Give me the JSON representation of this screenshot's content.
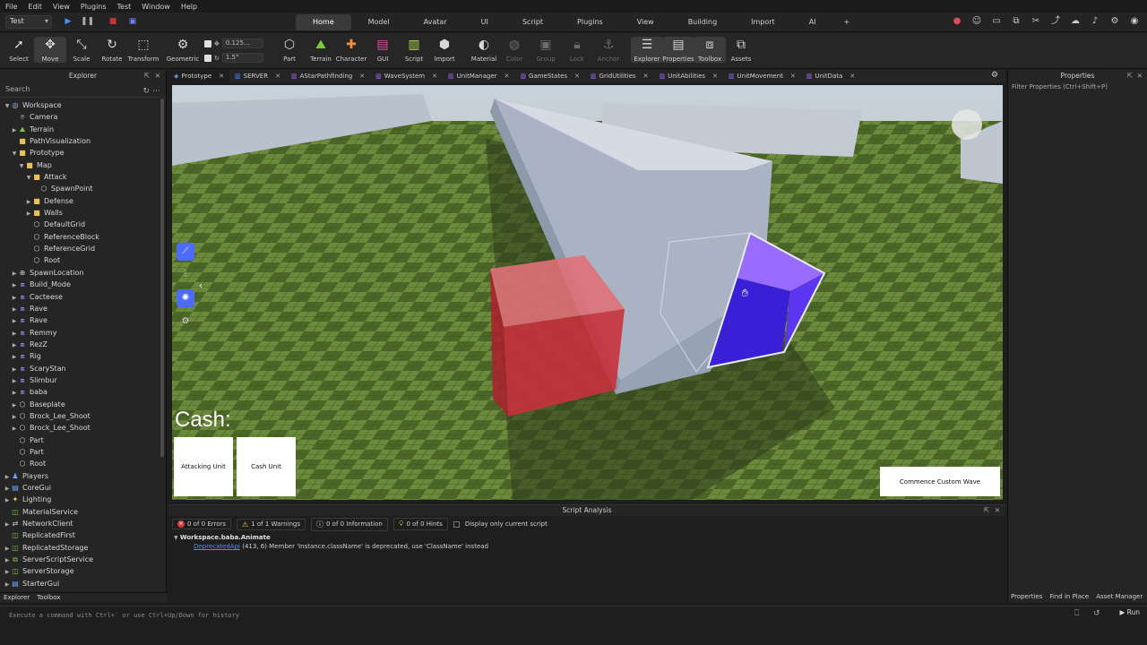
{
  "menu": [
    "File",
    "Edit",
    "View",
    "Plugins",
    "Test",
    "Window",
    "Help"
  ],
  "test_mode": "Test",
  "ribbon_tabs": [
    "Home",
    "Model",
    "Avatar",
    "UI",
    "Script",
    "Plugins",
    "View",
    "Building",
    "Import",
    "AI"
  ],
  "active_ribbon_tab": "Home",
  "toolbar": {
    "tools": [
      {
        "label": "Select",
        "icon": "cursor-icon"
      },
      {
        "label": "Move",
        "icon": "move-icon"
      },
      {
        "label": "Scale",
        "icon": "scale-icon"
      },
      {
        "label": "Rotate",
        "icon": "rotate-icon"
      },
      {
        "label": "Transform",
        "icon": "transform-icon"
      }
    ],
    "geometric_label": "Geometric",
    "snap_move": "0.125...",
    "snap_rotate": "1.5°",
    "insert_tools": [
      "Part",
      "Terrain",
      "Character",
      "GUI",
      "Script",
      "Import"
    ],
    "material_tools": [
      "Material",
      "Color",
      "Group",
      "Lock",
      "Anchor"
    ],
    "panel_tools": [
      "Explorer",
      "Properties",
      "Toolbox",
      "Assets"
    ]
  },
  "explorer": {
    "title": "Explorer",
    "search_placeholder": "Search",
    "items": [
      {
        "name": "Workspace",
        "depth": 0,
        "expand": "open",
        "icon": "workspace"
      },
      {
        "name": "Camera",
        "depth": 1,
        "expand": "",
        "icon": "camera"
      },
      {
        "name": "Terrain",
        "depth": 1,
        "expand": "closed",
        "icon": "terrain"
      },
      {
        "name": "PathVisualization",
        "depth": 1,
        "expand": "",
        "icon": "folder"
      },
      {
        "name": "Prototype",
        "depth": 1,
        "expand": "open",
        "icon": "folder"
      },
      {
        "name": "Map",
        "depth": 2,
        "expand": "open",
        "icon": "folder"
      },
      {
        "name": "Attack",
        "depth": 3,
        "expand": "open",
        "icon": "folder"
      },
      {
        "name": "SpawnPoint",
        "depth": 4,
        "expand": "",
        "icon": "part"
      },
      {
        "name": "Defense",
        "depth": 3,
        "expand": "closed",
        "icon": "folder"
      },
      {
        "name": "Walls",
        "depth": 3,
        "expand": "closed",
        "icon": "folder"
      },
      {
        "name": "DefaultGrid",
        "depth": 3,
        "expand": "",
        "icon": "part"
      },
      {
        "name": "ReferenceBlock",
        "depth": 3,
        "expand": "",
        "icon": "part"
      },
      {
        "name": "ReferenceGrid",
        "depth": 3,
        "expand": "",
        "icon": "part"
      },
      {
        "name": "Root",
        "depth": 3,
        "expand": "",
        "icon": "part"
      },
      {
        "name": "SpawnLocation",
        "depth": 1,
        "expand": "closed",
        "icon": "spawn"
      },
      {
        "name": "Build_Mode",
        "depth": 1,
        "expand": "closed",
        "icon": "model"
      },
      {
        "name": "Cacteese",
        "depth": 1,
        "expand": "closed",
        "icon": "model"
      },
      {
        "name": "Rave",
        "depth": 1,
        "expand": "closed",
        "icon": "model"
      },
      {
        "name": "Rave",
        "depth": 1,
        "expand": "closed",
        "icon": "model"
      },
      {
        "name": "Remmy",
        "depth": 1,
        "expand": "closed",
        "icon": "model"
      },
      {
        "name": "RezZ",
        "depth": 1,
        "expand": "closed",
        "icon": "model"
      },
      {
        "name": "Rig",
        "depth": 1,
        "expand": "closed",
        "icon": "model"
      },
      {
        "name": "ScaryStan",
        "depth": 1,
        "expand": "closed",
        "icon": "model"
      },
      {
        "name": "Slimbur",
        "depth": 1,
        "expand": "closed",
        "icon": "model"
      },
      {
        "name": "baba",
        "depth": 1,
        "expand": "closed",
        "icon": "model"
      },
      {
        "name": "Baseplate",
        "depth": 1,
        "expand": "closed",
        "icon": "part"
      },
      {
        "name": "Brock_Lee_Shoot",
        "depth": 1,
        "expand": "closed",
        "icon": "part"
      },
      {
        "name": "Brock_Lee_Shoot",
        "depth": 1,
        "expand": "closed",
        "icon": "part"
      },
      {
        "name": "Part",
        "depth": 1,
        "expand": "",
        "icon": "part"
      },
      {
        "name": "Part",
        "depth": 1,
        "expand": "",
        "icon": "part"
      },
      {
        "name": "Root",
        "depth": 1,
        "expand": "",
        "icon": "part"
      },
      {
        "name": "Players",
        "depth": 0,
        "expand": "closed",
        "icon": "players"
      },
      {
        "name": "CoreGui",
        "depth": 0,
        "expand": "closed",
        "icon": "gui"
      },
      {
        "name": "Lighting",
        "depth": 0,
        "expand": "closed",
        "icon": "lighting"
      },
      {
        "name": "MaterialService",
        "depth": 0,
        "expand": "",
        "icon": "service"
      },
      {
        "name": "NetworkClient",
        "depth": 0,
        "expand": "closed",
        "icon": "network"
      },
      {
        "name": "ReplicatedFirst",
        "depth": 0,
        "expand": "",
        "icon": "service"
      },
      {
        "name": "ReplicatedStorage",
        "depth": 0,
        "expand": "closed",
        "icon": "service"
      },
      {
        "name": "ServerScriptService",
        "depth": 0,
        "expand": "closed",
        "icon": "script-service"
      },
      {
        "name": "ServerStorage",
        "depth": 0,
        "expand": "closed",
        "icon": "service"
      },
      {
        "name": "StarterGui",
        "depth": 0,
        "expand": "closed",
        "icon": "gui"
      }
    ],
    "footer_tabs": [
      "Explorer",
      "Toolbox"
    ]
  },
  "doc_tabs": [
    "Prototype",
    "SERVER",
    "AStarPathfinding",
    "WaveSystem",
    "UnitManager",
    "GameStates",
    "GridUtilities",
    "UnitAbilities",
    "UnitMovement",
    "UnitData"
  ],
  "viewport": {
    "cash_label": "Cash:",
    "attacking_unit_button": "Attacking Unit",
    "cash_unit_button": "Cash Unit",
    "commence_button": "Commence Custom Wave"
  },
  "script_analysis": {
    "title": "Script Analysis",
    "errors": "0 of 0 Errors",
    "warnings": "1 of 1 Warnings",
    "information": "0 of 0 Information",
    "hints": "0 of 0 Hints",
    "display_only_current": "Display only current script",
    "entry_script": "Workspace.baba.Animate",
    "entry_link": "DeprecatedApi",
    "entry_message": "(413, 6) Member 'Instance.className' is deprecated, use 'ClassName' instead"
  },
  "properties": {
    "title": "Properties",
    "filter_placeholder": "Filter Properties (Ctrl+Shift+P)",
    "footer_tabs": [
      "Properties",
      "Find in Place",
      "Asset Manager"
    ]
  },
  "command_bar": {
    "placeholder": "Execute a command with Ctrl+` or use Ctrl+Up/Down for history",
    "run_label": "Run"
  },
  "colors": {
    "accent": "#4d6bff",
    "selected_part_top": "#8a4dff",
    "selected_part_side": "#3a1fd6",
    "red_part": "#d8323c",
    "wall": "#a9b3c4",
    "grass": "#5a7a30"
  }
}
